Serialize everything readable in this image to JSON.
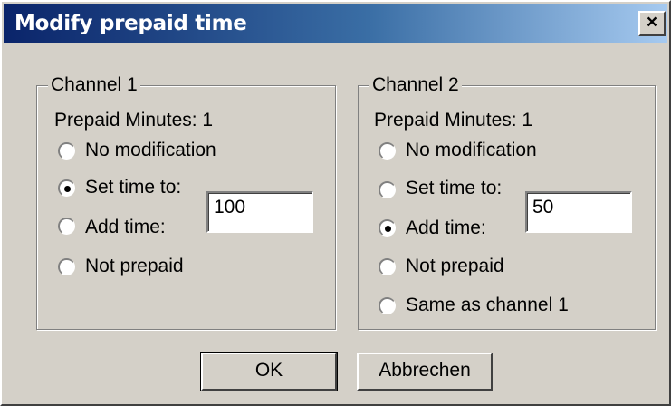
{
  "window": {
    "title": "Modify prepaid time",
    "close_glyph": "×"
  },
  "channel1": {
    "label": "Channel 1",
    "prepaid_minutes": "Prepaid Minutes: 1",
    "options": [
      {
        "label": "No modification",
        "checked": false
      },
      {
        "label": "Set time to:",
        "checked": true
      },
      {
        "label": "Add time:",
        "checked": false
      },
      {
        "label": "Not prepaid",
        "checked": false
      }
    ],
    "time_value": "100"
  },
  "channel2": {
    "label": "Channel 2",
    "prepaid_minutes": "Prepaid Minutes: 1",
    "options": [
      {
        "label": "No modification",
        "checked": false
      },
      {
        "label": "Set time to:",
        "checked": false
      },
      {
        "label": "Add time:",
        "checked": true
      },
      {
        "label": "Not prepaid",
        "checked": false
      },
      {
        "label": "Same as channel 1",
        "checked": false
      }
    ],
    "time_value": "50"
  },
  "buttons": {
    "ok": "OK",
    "cancel": "Abbrechen"
  },
  "colors": {
    "title_start": "#0a246a",
    "title_end": "#a6caf0",
    "face": "#d4d0c8"
  }
}
